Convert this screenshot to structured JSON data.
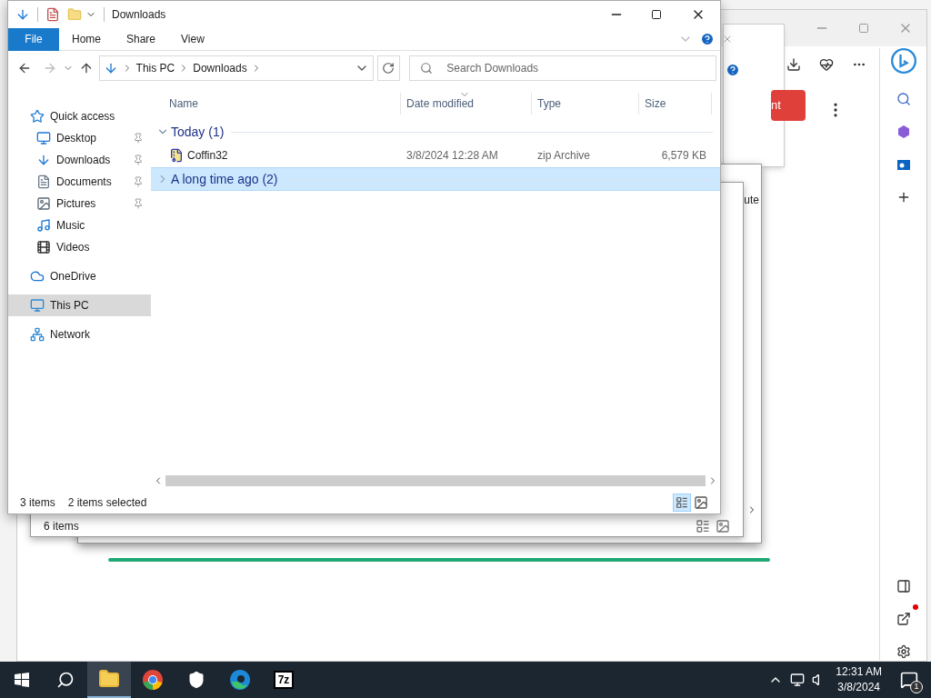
{
  "explorer": {
    "title": "Downloads",
    "ribbon_tabs": [
      {
        "label": "File",
        "selected": true
      },
      {
        "label": "Home",
        "selected": false
      },
      {
        "label": "Share",
        "selected": false
      },
      {
        "label": "View",
        "selected": false
      }
    ],
    "breadcrumb": [
      "This PC",
      "Downloads"
    ],
    "search": {
      "placeholder": "Search Downloads"
    },
    "nav": [
      {
        "label": "Quick access",
        "kind": "star",
        "selected": false,
        "children": [
          {
            "label": "Desktop",
            "kind": "desktop",
            "pinned": true,
            "selected": false
          },
          {
            "label": "Downloads",
            "kind": "download",
            "pinned": true,
            "selected": false
          },
          {
            "label": "Documents",
            "kind": "document",
            "pinned": true,
            "selected": false
          },
          {
            "label": "Pictures",
            "kind": "picture",
            "pinned": true,
            "selected": false
          },
          {
            "label": "Music",
            "kind": "music",
            "pinned": false,
            "selected": false
          },
          {
            "label": "Videos",
            "kind": "video",
            "pinned": false,
            "selected": false
          }
        ]
      },
      {
        "label": "OneDrive",
        "kind": "cloud",
        "selected": false
      },
      {
        "label": "This PC",
        "kind": "pc",
        "selected": true
      },
      {
        "label": "Network",
        "kind": "network",
        "selected": false
      }
    ],
    "columns": [
      {
        "label": "Name",
        "sorted": false
      },
      {
        "label": "Date modified",
        "sorted": true
      },
      {
        "label": "Type",
        "sorted": false
      },
      {
        "label": "Size",
        "sorted": false
      }
    ],
    "groups": [
      {
        "label": "Today (1)",
        "expanded": true,
        "selected": false,
        "items": [
          {
            "name": "Coffin32",
            "date": "3/8/2024 12:28 AM",
            "type": "zip Archive",
            "size": "6,579 KB"
          }
        ]
      },
      {
        "label": "A long time ago (2)",
        "expanded": false,
        "selected": true
      }
    ],
    "status": {
      "count": "3 items",
      "selection": "2 items selected"
    }
  },
  "back_window": {
    "status": "6 items"
  },
  "browser": {
    "button": "nt",
    "fragment": "ute"
  },
  "taskbar": {
    "apps": [
      {
        "kind": "start",
        "active": false
      },
      {
        "kind": "search",
        "active": false
      },
      {
        "kind": "explorer",
        "active": true
      },
      {
        "kind": "chrome",
        "active": false
      },
      {
        "kind": "security",
        "active": false
      },
      {
        "kind": "edge",
        "active": false
      },
      {
        "kind": "sevenzip",
        "active": false,
        "label": "7z"
      }
    ],
    "time": "12:31 AM",
    "date": "3/8/2024",
    "notifications": "1"
  }
}
